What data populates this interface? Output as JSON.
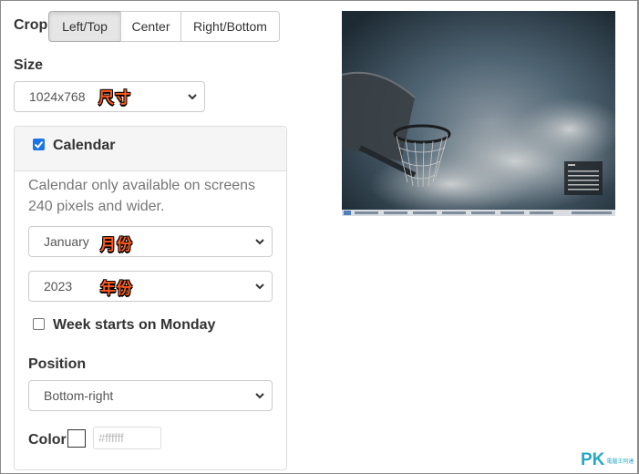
{
  "crop": {
    "label": "Crop",
    "options": [
      "Left/Top",
      "Center",
      "Right/Bottom"
    ],
    "selected": "Left/Top"
  },
  "size": {
    "label": "Size",
    "value": "1024x768",
    "annotation": "尺寸"
  },
  "calendar": {
    "enabled": true,
    "label": "Calendar",
    "help_text": "Calendar only available on screens 240 pixels and wider.",
    "month": {
      "value": "January",
      "annotation": "月份"
    },
    "year": {
      "value": "2023",
      "annotation": "年份"
    },
    "week_monday": {
      "checked": false,
      "label": "Week starts on Monday"
    },
    "position": {
      "label": "Position",
      "value": "Bottom-right"
    },
    "color": {
      "label": "Color",
      "swatch": "#ffffff",
      "placeholder": "#ffffff"
    }
  },
  "watermark": {
    "brand": "PK",
    "sub": "電腦王阿達"
  },
  "icons": {
    "chevron": "chevron-down-icon",
    "check": "checkmark-icon"
  }
}
